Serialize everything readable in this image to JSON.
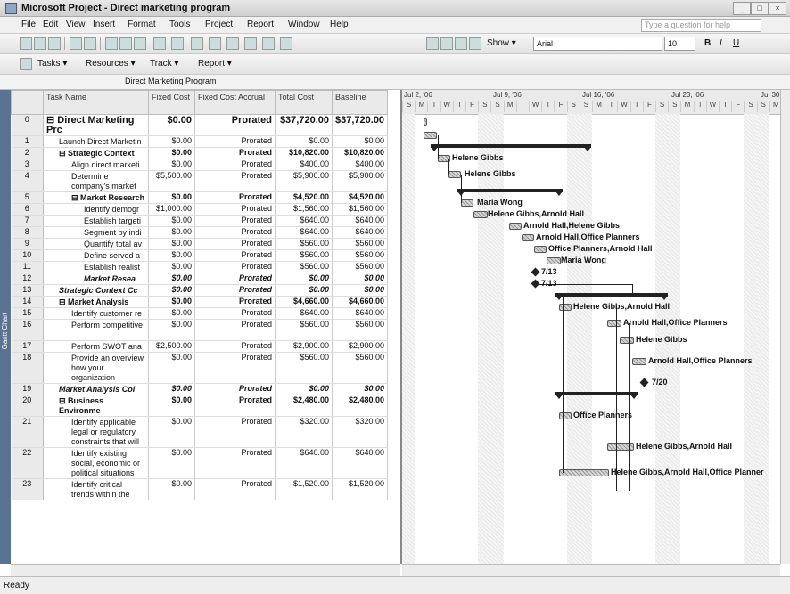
{
  "window": {
    "title": "Microsoft Project - Direct marketing program"
  },
  "menu": {
    "items": [
      "File",
      "Edit",
      "View",
      "Insert",
      "Format",
      "Tools",
      "Project",
      "Report",
      "Window",
      "Help"
    ],
    "ask_placeholder": "Type a question for help"
  },
  "toolbar1": {
    "show_label": "Show ▾",
    "font": "Arial",
    "size": "10",
    "bold": "B",
    "italic": "I",
    "underline": "U"
  },
  "toolbar2": {
    "tasks": "Tasks ▾",
    "resources": "Resources ▾",
    "track": "Track ▾",
    "report": "Report ▾"
  },
  "entry_bar": {
    "value": "Direct Marketing Program"
  },
  "view_bar": {
    "label": "Gantt Chart"
  },
  "columns": [
    "Task Name",
    "Fixed Cost",
    "Fixed Cost Accrual",
    "Total Cost",
    "Baseline"
  ],
  "rows": [
    {
      "id": "0",
      "name": "Direct Marketing Prc",
      "fixed": "$0.00",
      "accrual": "Prorated",
      "total": "$37,720.00",
      "baseline": "$37,720.00",
      "style": "b",
      "indent": 0,
      "sum": true
    },
    {
      "id": "1",
      "name": "Launch Direct Marketin",
      "fixed": "$0.00",
      "accrual": "Prorated",
      "total": "$0.00",
      "baseline": "$0.00",
      "style": "",
      "indent": 1
    },
    {
      "id": "2",
      "name": "Strategic Context",
      "fixed": "$0.00",
      "accrual": "Prorated",
      "total": "$10,820.00",
      "baseline": "$10,820.00",
      "style": "b",
      "indent": 1,
      "sum": true
    },
    {
      "id": "3",
      "name": "Align direct marketi",
      "fixed": "$0.00",
      "accrual": "Prorated",
      "total": "$400.00",
      "baseline": "$400.00",
      "style": "",
      "indent": 2
    },
    {
      "id": "4",
      "name": "Determine company's market",
      "fixed": "$5,500.00",
      "accrual": "Prorated",
      "total": "$5,900.00",
      "baseline": "$5,900.00",
      "style": "",
      "indent": 2
    },
    {
      "id": "5",
      "name": "Market Research",
      "fixed": "$0.00",
      "accrual": "Prorated",
      "total": "$4,520.00",
      "baseline": "$4,520.00",
      "style": "b",
      "indent": 2,
      "sum": true
    },
    {
      "id": "6",
      "name": "Identify demogr",
      "fixed": "$1,000.00",
      "accrual": "Prorated",
      "total": "$1,560.00",
      "baseline": "$1,560.00",
      "style": "",
      "indent": 3
    },
    {
      "id": "7",
      "name": "Establish targeti",
      "fixed": "$0.00",
      "accrual": "Prorated",
      "total": "$640.00",
      "baseline": "$640.00",
      "style": "",
      "indent": 3
    },
    {
      "id": "8",
      "name": "Segment by indi",
      "fixed": "$0.00",
      "accrual": "Prorated",
      "total": "$640.00",
      "baseline": "$640.00",
      "style": "",
      "indent": 3
    },
    {
      "id": "9",
      "name": "Quantify total av",
      "fixed": "$0.00",
      "accrual": "Prorated",
      "total": "$560.00",
      "baseline": "$560.00",
      "style": "",
      "indent": 3
    },
    {
      "id": "10",
      "name": "Define served a",
      "fixed": "$0.00",
      "accrual": "Prorated",
      "total": "$560.00",
      "baseline": "$560.00",
      "style": "",
      "indent": 3
    },
    {
      "id": "11",
      "name": "Establish realist",
      "fixed": "$0.00",
      "accrual": "Prorated",
      "total": "$560.00",
      "baseline": "$560.00",
      "style": "",
      "indent": 3
    },
    {
      "id": "12",
      "name": "Market Resea",
      "fixed": "$0.00",
      "accrual": "Prorated",
      "total": "$0.00",
      "baseline": "$0.00",
      "style": "bi",
      "indent": 3
    },
    {
      "id": "13",
      "name": "Strategic Context Cc",
      "fixed": "$0.00",
      "accrual": "Prorated",
      "total": "$0.00",
      "baseline": "$0.00",
      "style": "bi",
      "indent": 1
    },
    {
      "id": "14",
      "name": "Market Analysis",
      "fixed": "$0.00",
      "accrual": "Prorated",
      "total": "$4,660.00",
      "baseline": "$4,660.00",
      "style": "b",
      "indent": 1,
      "sum": true
    },
    {
      "id": "15",
      "name": "Identify customer re",
      "fixed": "$0.00",
      "accrual": "Prorated",
      "total": "$640.00",
      "baseline": "$640.00",
      "style": "",
      "indent": 2
    },
    {
      "id": "16",
      "name": "Perform competitive",
      "fixed": "$0.00",
      "accrual": "Prorated",
      "total": "$560.00",
      "baseline": "$560.00",
      "style": "",
      "indent": 2
    },
    {
      "id": "17",
      "name": "Perform SWOT ana",
      "fixed": "$2,500.00",
      "accrual": "Prorated",
      "total": "$2,900.00",
      "baseline": "$2,900.00",
      "style": "",
      "indent": 2
    },
    {
      "id": "18",
      "name": "Provide an overview how your organization",
      "fixed": "$0.00",
      "accrual": "Prorated",
      "total": "$560.00",
      "baseline": "$560.00",
      "style": "",
      "indent": 2
    },
    {
      "id": "19",
      "name": "Market Analysis Coi",
      "fixed": "$0.00",
      "accrual": "Prorated",
      "total": "$0.00",
      "baseline": "$0.00",
      "style": "bi",
      "indent": 1
    },
    {
      "id": "20",
      "name": "Business Environme",
      "fixed": "$0.00",
      "accrual": "Prorated",
      "total": "$2,480.00",
      "baseline": "$2,480.00",
      "style": "b",
      "indent": 1,
      "sum": true
    },
    {
      "id": "21",
      "name": "Identify applicable legal or regulatory constraints that will",
      "fixed": "$0.00",
      "accrual": "Prorated",
      "total": "$320.00",
      "baseline": "$320.00",
      "style": "",
      "indent": 2
    },
    {
      "id": "22",
      "name": "Identify existing social, economic or political situations",
      "fixed": "$0.00",
      "accrual": "Prorated",
      "total": "$640.00",
      "baseline": "$640.00",
      "style": "",
      "indent": 2
    },
    {
      "id": "23",
      "name": "Identify critical trends within the",
      "fixed": "$0.00",
      "accrual": "Prorated",
      "total": "$1,520.00",
      "baseline": "$1,520.00",
      "style": "",
      "indent": 2
    }
  ],
  "timescale": {
    "weeks": [
      "Jul 2, '06",
      "Jul 9, '06",
      "Jul 16, '06",
      "Jul 23, '06",
      "Jul 30"
    ],
    "days": [
      "S",
      "M",
      "T",
      "W",
      "T",
      "F",
      "S"
    ]
  },
  "gantt_labels": {
    "r3": "Helene Gibbs",
    "r4": "Helene Gibbs",
    "r6": "Maria Wong",
    "r7": "Helene Gibbs,Arnold Hall",
    "r8": "Arnold Hall,Helene Gibbs",
    "r9": "Arnold Hall,Office Planners",
    "r10": "Office Planners,Arnold Hall",
    "r11": "Maria Wong",
    "r12": "7/13",
    "r13": "7/13",
    "r15": "Helene Gibbs,Arnold Hall",
    "r16": "Arnold Hall,Office Planners",
    "r17": "Helene Gibbs",
    "r18": "Arnold Hall,Office Planners",
    "r19": "7/20",
    "r21": "Office Planners",
    "r22": "Helene Gibbs,Arnold Hall",
    "r23": "Helene Gibbs,Arnold Hall,Office Planner"
  },
  "status": {
    "text": "Ready"
  }
}
